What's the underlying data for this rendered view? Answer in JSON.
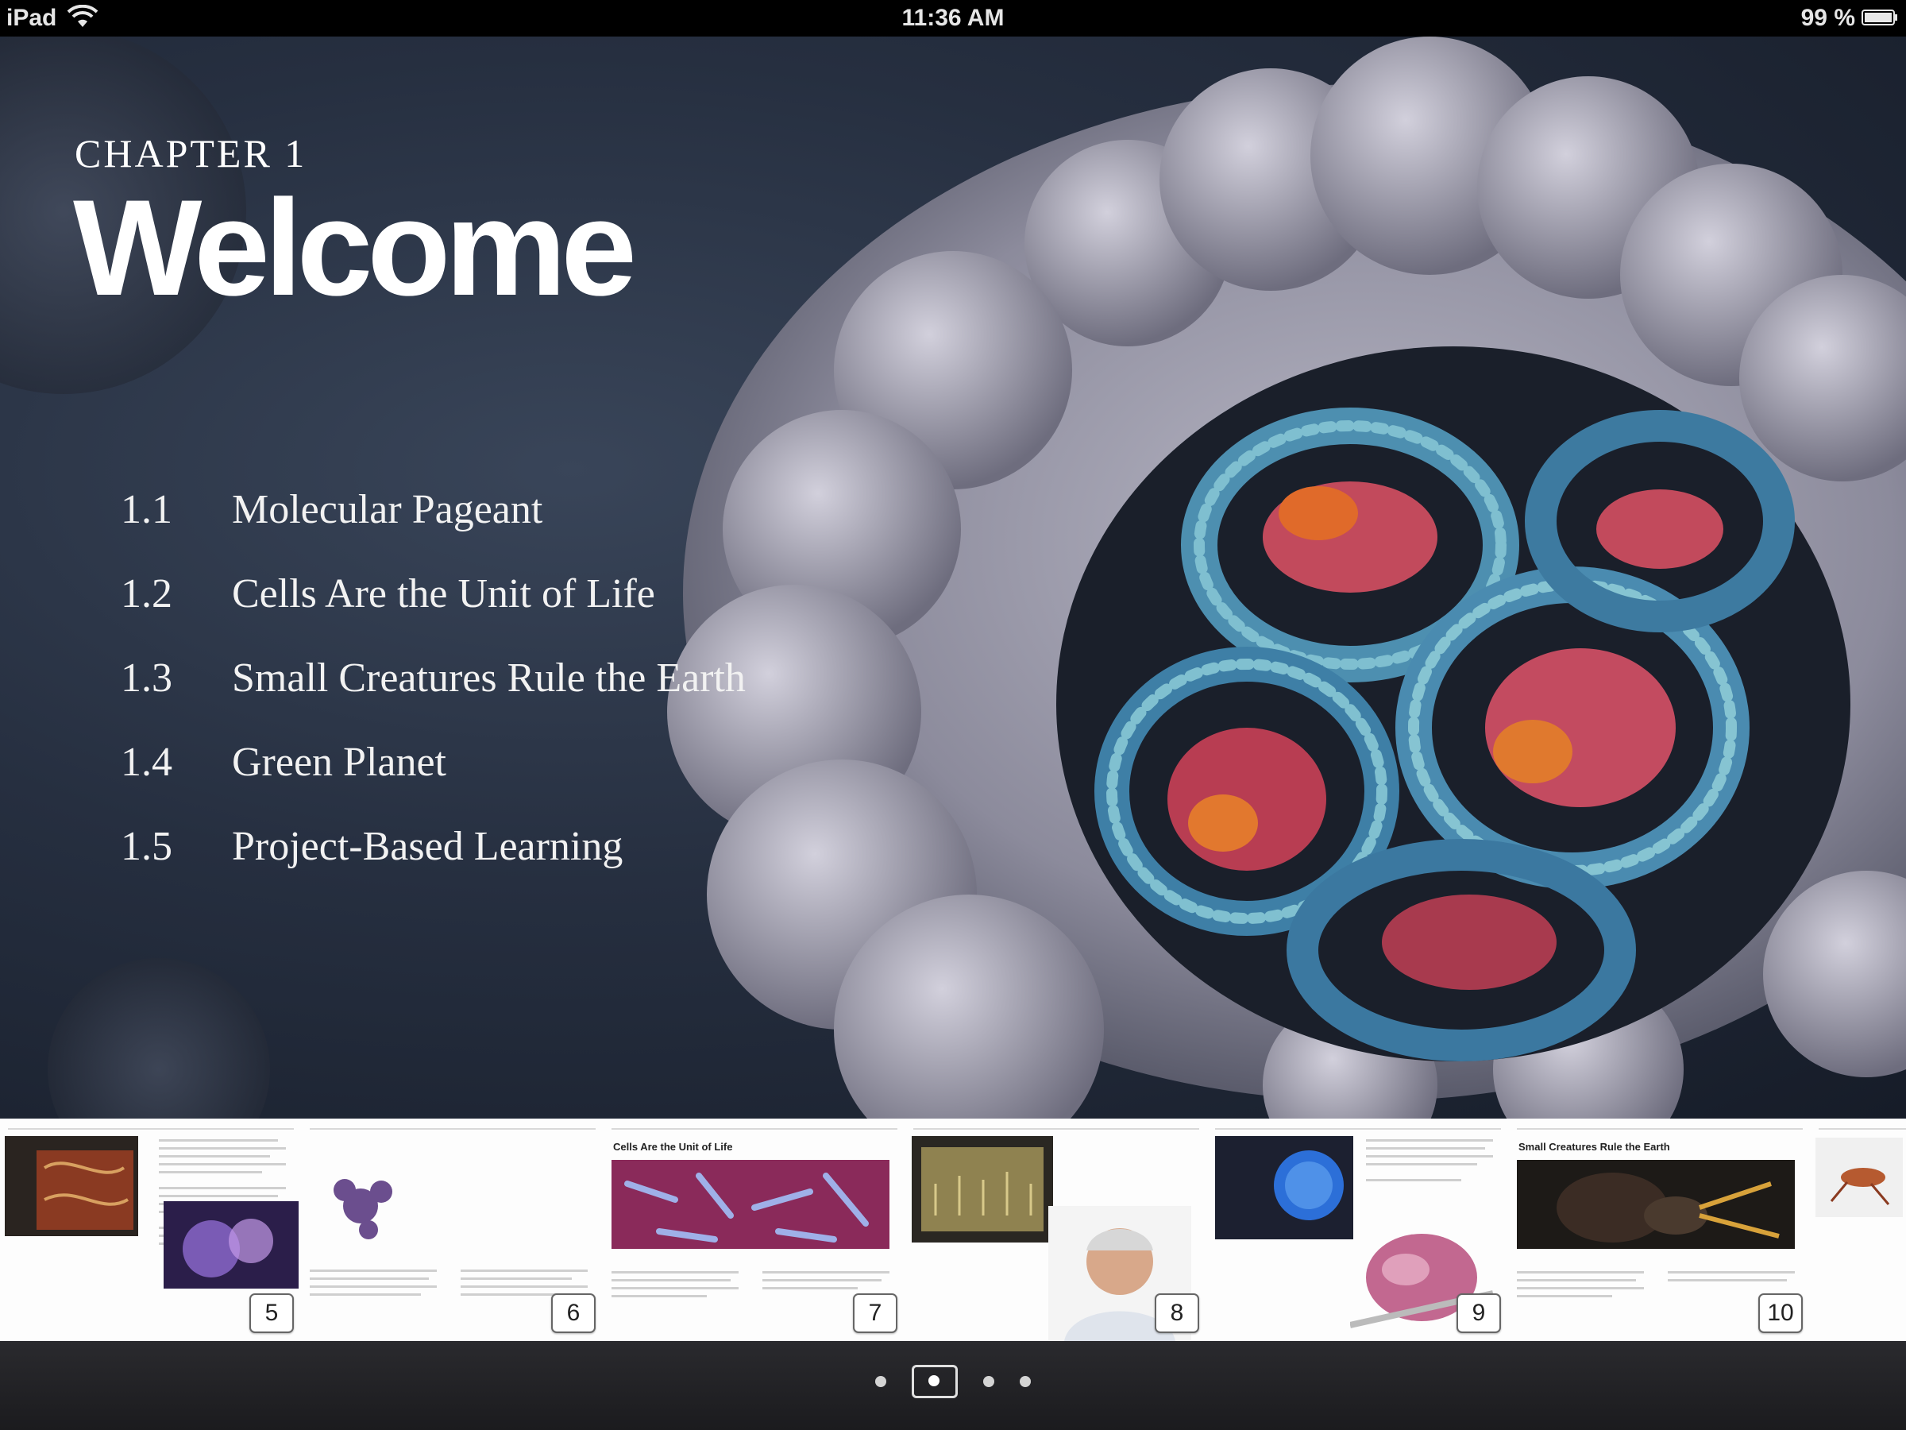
{
  "status_bar": {
    "device": "iPad",
    "wifi_icon": "wifi-icon",
    "time": "11:36 AM",
    "battery": "99 %",
    "battery_icon": "battery-icon"
  },
  "chapter": {
    "label": "CHAPTER 1",
    "title": "Welcome",
    "sections": [
      {
        "number": "1.1",
        "title": "Molecular Pageant"
      },
      {
        "number": "1.2",
        "title": "Cells Are the Unit of Life"
      },
      {
        "number": "1.3",
        "title": "Small Creatures Rule the Earth"
      },
      {
        "number": "1.4",
        "title": "Green Planet"
      },
      {
        "number": "1.5",
        "title": "Project-Based Learning"
      }
    ]
  },
  "pages": [
    {
      "number": "5",
      "heading": ""
    },
    {
      "number": "6",
      "heading": ""
    },
    {
      "number": "7",
      "heading": "Cells Are the Unit of Life"
    },
    {
      "number": "8",
      "heading": ""
    },
    {
      "number": "9",
      "heading": ""
    },
    {
      "number": "10",
      "heading": "Small Creatures Rule the Earth"
    }
  ],
  "pager": {
    "total": 4,
    "active": 2
  },
  "colors": {
    "hero_background": "#262f40",
    "text": "#ffffff",
    "strip_background": "#ffffff",
    "bottom_bar": "#1f1f22"
  }
}
